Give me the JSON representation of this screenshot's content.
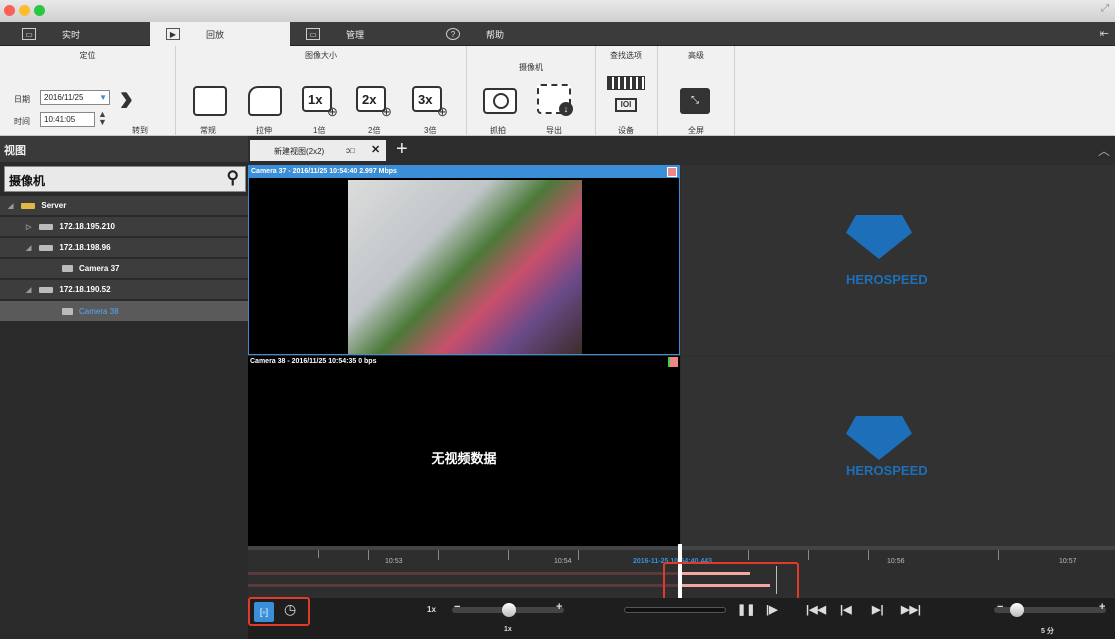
{
  "menu": {
    "tabs": [
      {
        "label": "实时",
        "icon": "monitor-icon"
      },
      {
        "label": "回放",
        "icon": "play-icon"
      },
      {
        "label": "管理",
        "icon": "folder-icon"
      },
      {
        "label": "帮助",
        "icon": "help-icon"
      }
    ]
  },
  "ribbon": {
    "locate": {
      "title": "定位",
      "date_label": "日期",
      "date_value": "2016/11/25",
      "time_label": "时间",
      "time_value": "10:41:05",
      "goto_label": "转到"
    },
    "image_size": {
      "title": "图像大小",
      "buttons": [
        "常规",
        "拉伸",
        "1倍",
        "2倍",
        "3倍"
      ],
      "zoom_marks": [
        "1x",
        "2x",
        "3x"
      ]
    },
    "camera": {
      "title": "摄像机",
      "buttons": [
        "抓拍",
        "导出"
      ]
    },
    "search": {
      "title": "查找选项",
      "button": "设备"
    },
    "advanced": {
      "title": "高级",
      "button": "全屏"
    }
  },
  "left_panel": {
    "header": "视图",
    "search_label": "摄像机",
    "tree": [
      {
        "label": "Server"
      },
      {
        "label": "172.18.195.210"
      },
      {
        "label": "172.18.198.96"
      },
      {
        "label": "Camera 37"
      },
      {
        "label": "172.18.190.52"
      },
      {
        "label": "Camera 38"
      }
    ]
  },
  "view_tab": {
    "label": "新建视图(2x2)",
    "suffix": "ↄ□"
  },
  "cells": {
    "cam37": "Camera 37  - 2016/11/25 10:54:40  2.997 Mbps",
    "cam38": "Camera 38  - 2016/11/25 10:54:35  0 bps",
    "no_video": "无视频数据",
    "logo": "HEROSPEED"
  },
  "timeline": {
    "ticks": [
      "10:53",
      "10:54",
      "10:56",
      "10:57"
    ],
    "cursor_time": "2016-11-25 10:54:40.443"
  },
  "controls": {
    "speed_left": "1x",
    "speed_below": "1x",
    "zoom_label": "5 分"
  },
  "colors": {
    "accent": "#3a8fd8",
    "highlight": "#e03a2a"
  }
}
